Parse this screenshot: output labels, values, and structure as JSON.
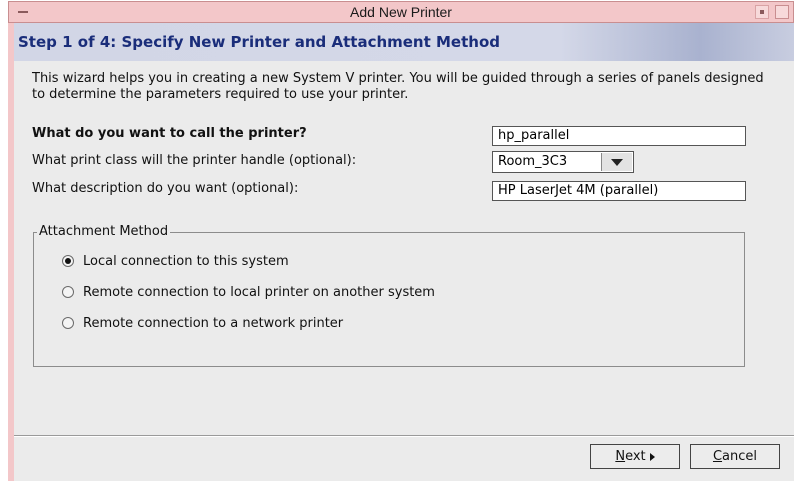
{
  "window": {
    "title": "Add New Printer"
  },
  "step": {
    "heading": "Step 1 of 4: Specify New Printer and Attachment Method"
  },
  "intro": "This wizard helps you in creating a new System V printer.  You will be guided through a series of panels designed to determine the parameters required to use your printer.",
  "form": {
    "name_label": "What do you want to call the printer?",
    "name_value": "hp_parallel",
    "class_label": "What print class will the printer handle (optional):",
    "class_value": "Room_3C3",
    "desc_label": "What description do you want (optional):",
    "desc_value": "HP LaserJet 4M (parallel)"
  },
  "attachment": {
    "title": "Attachment Method",
    "options": [
      {
        "label": "Local connection to this system",
        "selected": true
      },
      {
        "label": "Remote connection to local printer on another system",
        "selected": false
      },
      {
        "label": "Remote connection to a network printer",
        "selected": false
      }
    ]
  },
  "buttons": {
    "next_mnemonic": "N",
    "next_rest": "ext",
    "cancel_mnemonic": "C",
    "cancel_rest": "ancel"
  },
  "icons": {
    "menu": "window-menu-icon",
    "minimize": "minimize-icon",
    "maximize": "maximize-icon",
    "dropdown": "dropdown-arrow-icon",
    "next": "next-arrow-icon"
  },
  "colors": {
    "titlebar": "#f3c7c9",
    "step_text": "#1a2d7a",
    "panel": "#ebebeb"
  }
}
